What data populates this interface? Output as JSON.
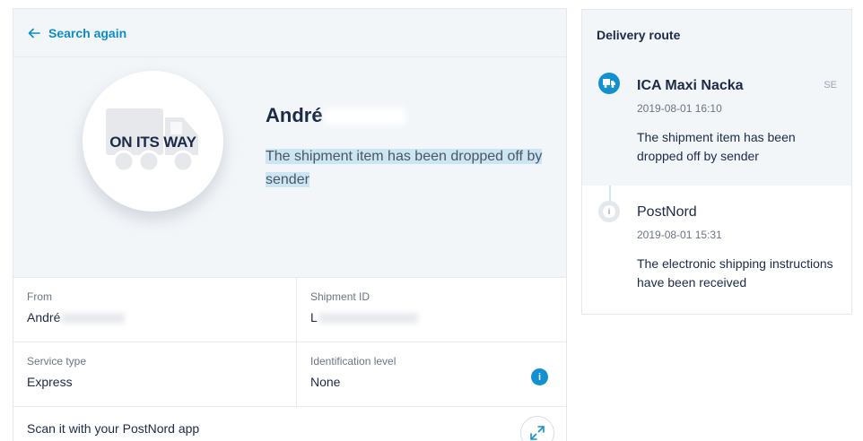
{
  "header": {
    "back_label": "Search again"
  },
  "status": {
    "badge": "ON ITS WAY",
    "recipient": "André",
    "description": "The shipment item has been dropped off by sender"
  },
  "details": {
    "from_label": "From",
    "from_value": "André",
    "shipment_id_label": "Shipment ID",
    "shipment_id_value": "L",
    "service_type_label": "Service type",
    "service_type_value": "Express",
    "identification_label": "Identification level",
    "identification_value": "None",
    "info_icon_glyph": "i"
  },
  "scan": {
    "label": "Scan it with your PostNord app"
  },
  "route": {
    "title": "Delivery route",
    "events": [
      {
        "place": "ICA Maxi Nacka",
        "country": "SE",
        "time": "2019-08-01 16:10",
        "description": "The shipment item has been dropped off by sender"
      },
      {
        "place": "PostNord",
        "time": "2019-08-01 15:31",
        "description": "The electronic shipping instructions have been received",
        "icon_glyph": "i"
      }
    ]
  },
  "colors": {
    "accent": "#1290d0",
    "link": "#0d8bc7",
    "panel_bg": "#f3f6f9",
    "text_dark": "#1c2a48"
  }
}
